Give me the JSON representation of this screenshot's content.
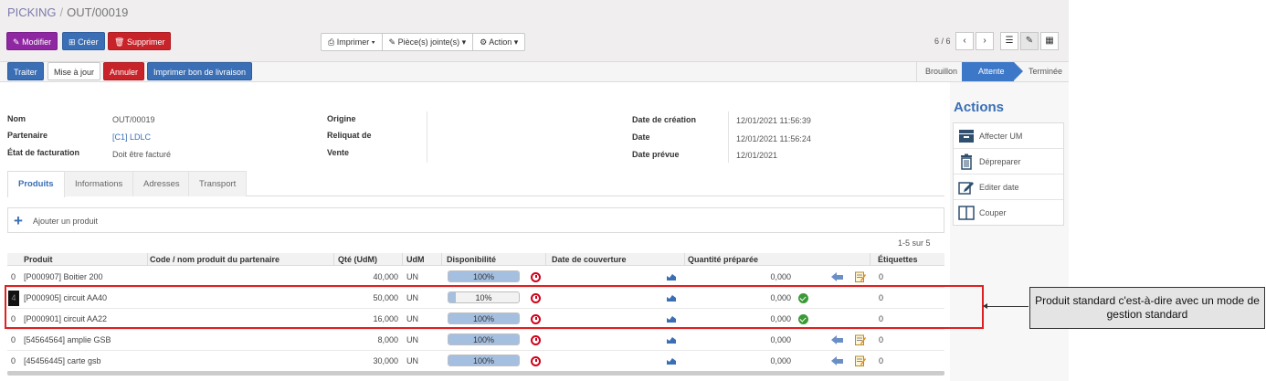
{
  "breadcrumb": {
    "parent": "PICKING",
    "separator": "/",
    "current": "OUT/00019"
  },
  "toolbar": {
    "edit_label": "Modifier",
    "create_label": "Créer",
    "delete_label": "Supprimer",
    "print_label": "Imprimer",
    "attachments_label": "Pièce(s) jointe(s)",
    "action_label": "Action",
    "pager": "6 / 6"
  },
  "buttons": {
    "process": "Traiter",
    "update": "Mise à jour",
    "cancel": "Annuler",
    "print_delivery": "Imprimer bon de livraison"
  },
  "stages": {
    "draft": "Brouillon",
    "waiting": "Attente",
    "done": "Terminée"
  },
  "form": {
    "name_label": "Nom",
    "name_value": "OUT/00019",
    "partner_label": "Partenaire",
    "partner_value": "[C1] LDLC",
    "invoice_state_label": "État de facturation",
    "invoice_state_value": "Doit être facturé",
    "origin_label": "Origine",
    "backorder_label": "Reliquat de",
    "sale_label": "Vente",
    "creation_date_label": "Date de création",
    "creation_date_value": "12/01/2021 11:56:39",
    "date_label": "Date",
    "date_value": "12/01/2021 11:56:24",
    "expected_date_label": "Date prévue",
    "expected_date_value": "12/01/2021"
  },
  "tabs": [
    "Produits",
    "Informations",
    "Adresses",
    "Transport"
  ],
  "add_product_label": "Ajouter un produit",
  "record_count": "1-5 sur 5",
  "table": {
    "headers": [
      "Produit",
      "Code / nom produit du partenaire",
      "Qté (UdM)",
      "UdM",
      "Disponibilité",
      "Date de couverture",
      "Quantité préparée",
      "Étiquettes"
    ],
    "rows": [
      {
        "index": "0",
        "product": "[P000907] Boitier 200",
        "qty": "40,000",
        "uom": "UN",
        "availability": 100,
        "availability_label": "100%",
        "prepared": "0,000",
        "labels": "0",
        "status": "warning",
        "actions": true
      },
      {
        "index": "4",
        "product": "[P000905] circuit AA40",
        "qty": "50,000",
        "uom": "UN",
        "availability": 10,
        "availability_label": "10%",
        "prepared": "0,000",
        "labels": "0",
        "status": "ok",
        "actions": false
      },
      {
        "index": "0",
        "product": "[P000901] circuit AA22",
        "qty": "16,000",
        "uom": "UN",
        "availability": 100,
        "availability_label": "100%",
        "prepared": "0,000",
        "labels": "0",
        "status": "ok",
        "actions": false
      },
      {
        "index": "0",
        "product": "[54564564] amplie GSB",
        "qty": "8,000",
        "uom": "UN",
        "availability": 100,
        "availability_label": "100%",
        "prepared": "0,000",
        "labels": "0",
        "status": "warning",
        "actions": true
      },
      {
        "index": "0",
        "product": "[45456445] carte gsb",
        "qty": "30,000",
        "uom": "UN",
        "availability": 100,
        "availability_label": "100%",
        "prepared": "0,000",
        "labels": "0",
        "status": "warning",
        "actions": true
      }
    ]
  },
  "actions_panel": {
    "title": "Actions",
    "items": [
      "Affecter UM",
      "Dépreparer",
      "Editer date",
      "Couper"
    ]
  },
  "annotation": {
    "text": "Produit standard c'est-à-dire avec un mode de gestion standard"
  },
  "colors": {
    "accent": "#3a6eb5",
    "brand": "#8f27a2",
    "danger": "#c9232a",
    "highlight": "#e02020"
  }
}
